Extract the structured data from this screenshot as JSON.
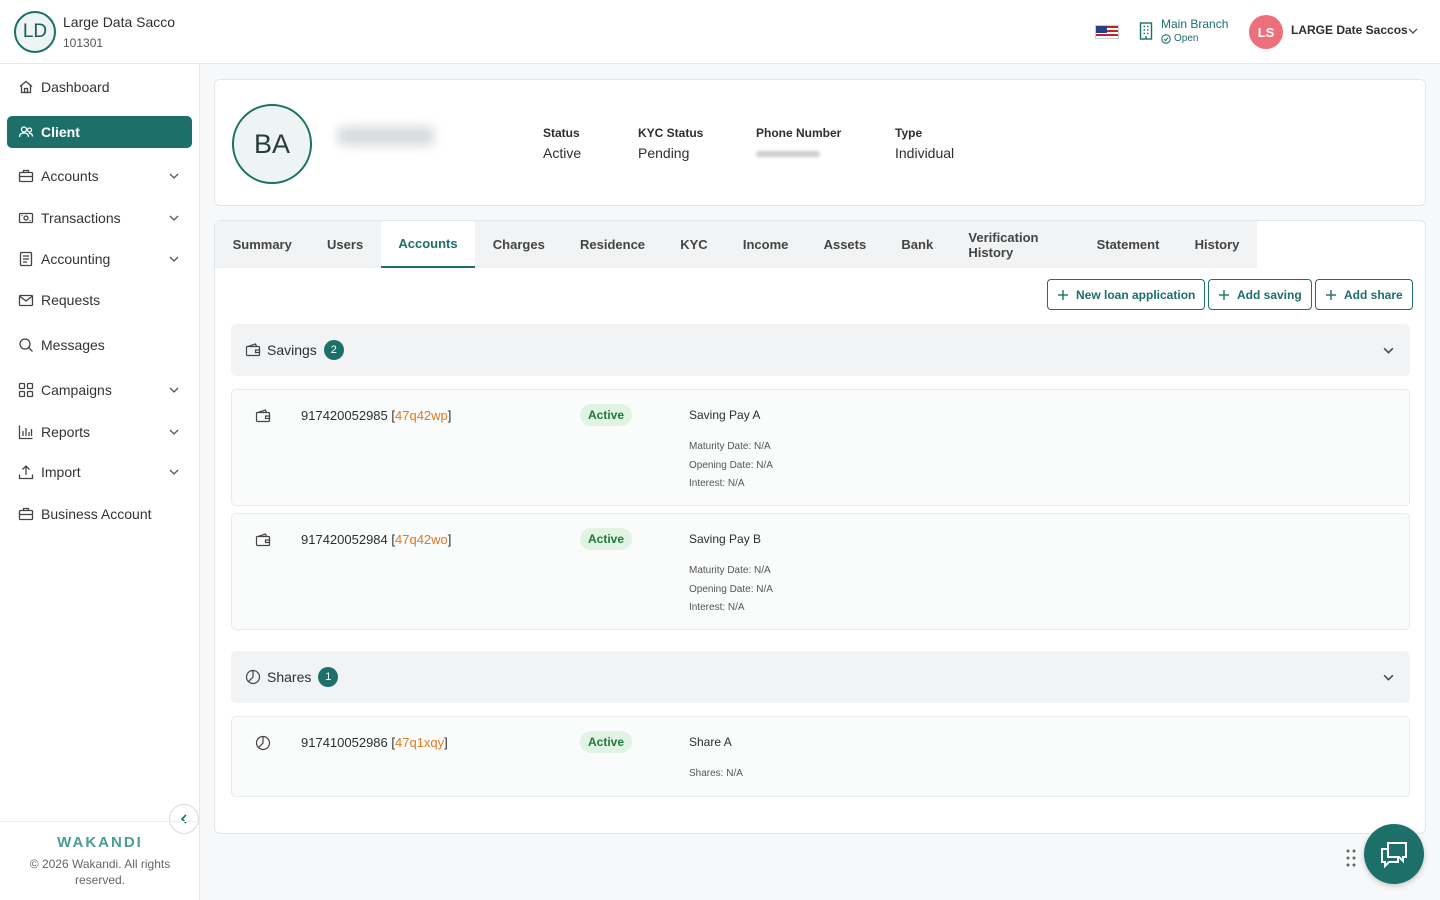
{
  "org": {
    "initials": "LD",
    "name": "Large Data Sacco",
    "code": "101301"
  },
  "header": {
    "branch_name": "Main Branch",
    "branch_status": "Open",
    "user_initials": "LS",
    "user_name": "LARGE Date Saccos"
  },
  "sidebar": {
    "items": [
      {
        "label": "Dashboard",
        "icon": "home-icon"
      },
      {
        "label": "Client",
        "icon": "users-icon",
        "active": true
      },
      {
        "label": "Accounts",
        "icon": "briefcase-icon"
      },
      {
        "label": "Transactions",
        "icon": "money-icon"
      },
      {
        "label": "Accounting",
        "icon": "ledger-icon"
      },
      {
        "label": "Requests",
        "icon": "mail-icon"
      },
      {
        "label": "Messages",
        "icon": "chat-search-icon"
      },
      {
        "label": "Campaigns",
        "icon": "grid-icon"
      },
      {
        "label": "Reports",
        "icon": "bar-chart-icon"
      },
      {
        "label": "Import",
        "icon": "upload-icon"
      },
      {
        "label": "Business Account",
        "icon": "briefcase-icon"
      }
    ],
    "brand": "WAKANDI",
    "copyright": "© 2026 Wakandi. All rights reserved."
  },
  "profile": {
    "initials": "BA",
    "status_label": "Status",
    "status_value": "Active",
    "kyc_label": "KYC Status",
    "kyc_value": "Pending",
    "phone_label": "Phone Number",
    "type_label": "Type",
    "type_value": "Individual"
  },
  "tabs": [
    "Summary",
    "Users",
    "Accounts",
    "Charges",
    "Residence",
    "KYC",
    "Income",
    "Assets",
    "Bank",
    "Verification History",
    "Statement",
    "History"
  ],
  "active_tab": "Accounts",
  "actions": {
    "new_loan": "New loan application",
    "add_saving": "Add saving",
    "add_share": "Add share"
  },
  "savings": {
    "title": "Savings",
    "count": "2",
    "accounts": [
      {
        "number": "917420052985",
        "code": "47q42wp",
        "status": "Active",
        "product": "Saving Pay A",
        "maturity": "Maturity Date: N/A",
        "opening": "Opening Date: N/A",
        "interest": "Interest: N/A"
      },
      {
        "number": "917420052984",
        "code": "47q42wo",
        "status": "Active",
        "product": "Saving Pay B",
        "maturity": "Maturity Date: N/A",
        "opening": "Opening Date: N/A",
        "interest": "Interest: N/A"
      }
    ]
  },
  "shares": {
    "title": "Shares",
    "count": "1",
    "accounts": [
      {
        "number": "917410052986",
        "code": "47q1xqy",
        "status": "Active",
        "product": "Share A",
        "shares": "Shares: N/A"
      }
    ]
  },
  "colors": {
    "primary": "#1d6f6a",
    "code_orange": "#e07a23",
    "badge_green_bg": "#e1f3e3",
    "user_avatar": "#ee6f7c"
  }
}
